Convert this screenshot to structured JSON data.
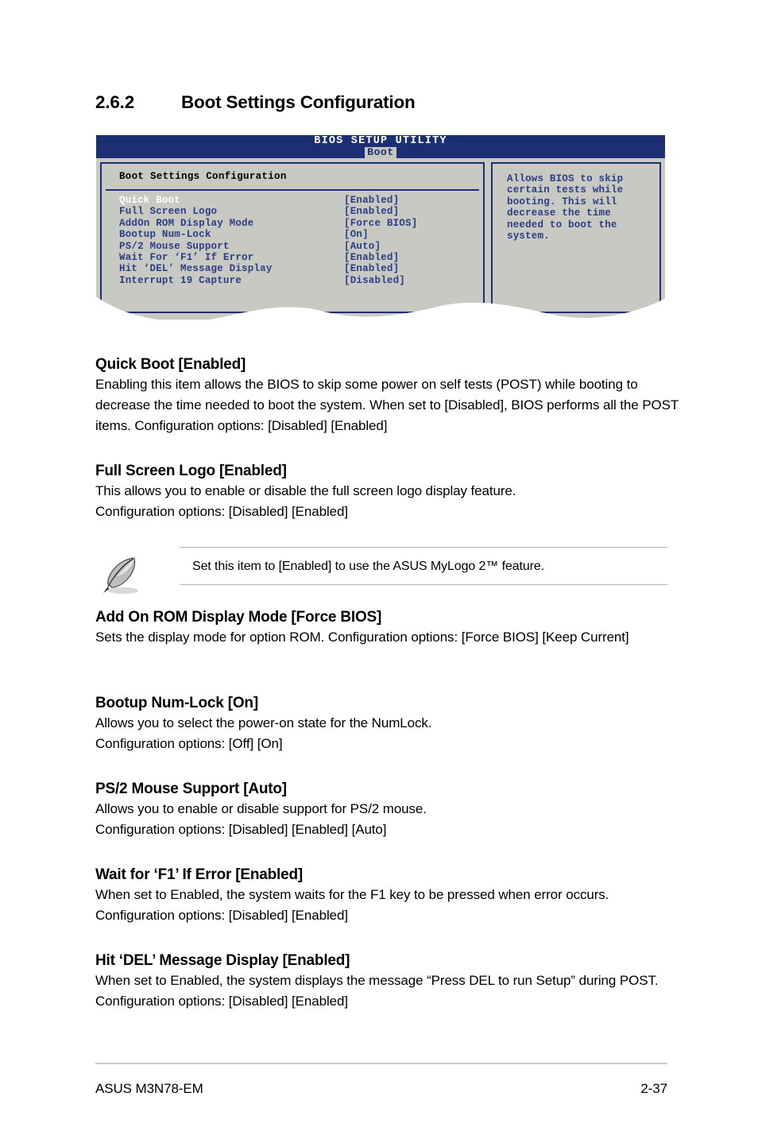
{
  "section": {
    "number": "2.6.2",
    "title": "Boot Settings Configuration"
  },
  "bios": {
    "window_title": "BIOS SETUP UTILITY",
    "active_tab": "Boot",
    "panel_heading": "Boot Settings Configuration",
    "options": [
      {
        "label": "Quick Boot",
        "value": "[Enabled]",
        "selected": true
      },
      {
        "label": "Full Screen Logo",
        "value": "[Enabled]",
        "selected": false
      },
      {
        "label": "AddOn ROM Display Mode",
        "value": "[Force BIOS]",
        "selected": false
      },
      {
        "label": "Bootup Num-Lock",
        "value": "[On]",
        "selected": false
      },
      {
        "label": "PS/2 Mouse Support",
        "value": "[Auto]",
        "selected": false
      },
      {
        "label": "Wait For ‘F1’ If Error",
        "value": "[Enabled]",
        "selected": false
      },
      {
        "label": "Hit ‘DEL’ Message Display",
        "value": "[Enabled]",
        "selected": false
      },
      {
        "label": "Interrupt 19 Capture",
        "value": "[Disabled]",
        "selected": false
      }
    ],
    "help_text": "Allows BIOS to skip certain tests while booting. This will decrease the time needed to boot the system.",
    "colors": {
      "titlebar": "#1b2f72",
      "panel_background": "#c9c9c3",
      "panel_border": "#1b2f72",
      "option_text": "#2b3d85",
      "selected_text": "#ffffff",
      "tab_background": "#c6c6c0"
    }
  },
  "items": [
    {
      "title": "Quick Boot [Enabled]",
      "body": "Enabling this item allows the BIOS to skip some power on self tests (POST) while booting to decrease the time needed to boot the system. When set to [Disabled], BIOS performs all the POST items. Configuration options: [Disabled] [Enabled]"
    },
    {
      "title": "Full Screen Logo [Enabled]",
      "body": "This allows you to enable or disable the full screen logo display feature.\nConfiguration options: [Disabled] [Enabled]"
    },
    {
      "title": "Add On ROM Display Mode [Force BIOS]",
      "body": "Sets the display mode for option ROM. Configuration options: [Force BIOS] [Keep Current]"
    },
    {
      "title": "Bootup Num-Lock [On]",
      "body": "Allows you to select the power-on state for the NumLock.\nConfiguration options: [Off] [On]"
    },
    {
      "title": "PS/2 Mouse Support [Auto]",
      "body": "Allows you to enable or disable support for PS/2 mouse.\nConfiguration options: [Disabled] [Enabled] [Auto]"
    },
    {
      "title": "Wait for ‘F1’ If Error [Enabled]",
      "body": "When set to Enabled, the system waits for the F1 key to be pressed when error occurs. Configuration options: [Disabled] [Enabled]"
    },
    {
      "title": "Hit ‘DEL’ Message Display [Enabled]",
      "body": "When set to Enabled, the system displays the message “Press DEL to run Setup” during POST. Configuration options: [Disabled] [Enabled]"
    }
  ],
  "note": {
    "icon": "quill-pen-icon",
    "text": "Set this item to [Enabled] to use the ASUS MyLogo 2™ feature."
  },
  "footer": {
    "left": "ASUS M3N78-EM",
    "right": "2-37"
  }
}
